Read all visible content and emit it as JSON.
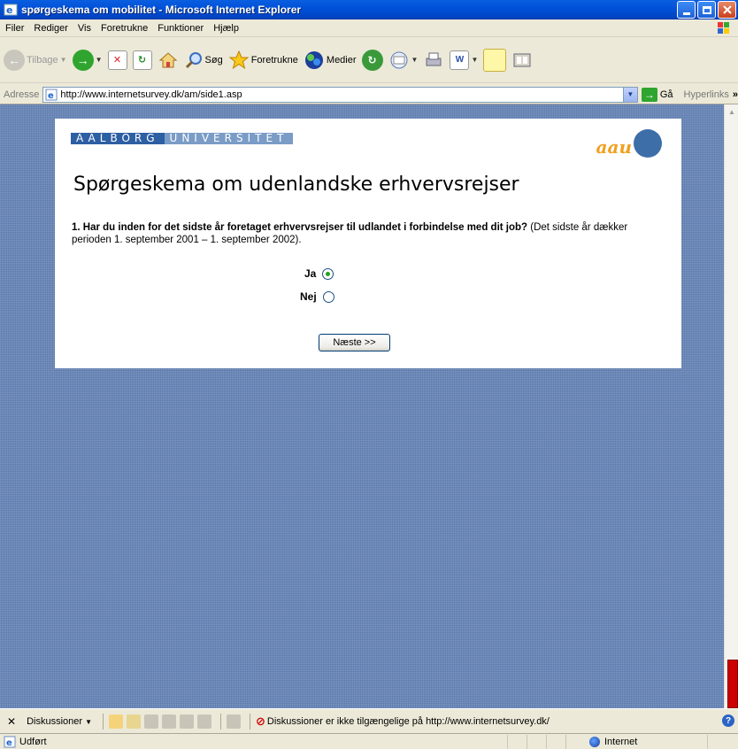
{
  "window": {
    "title": "spørgeskema om mobilitet - Microsoft Internet Explorer"
  },
  "menu": {
    "items": [
      "Filer",
      "Rediger",
      "Vis",
      "Foretrukne",
      "Funktioner",
      "Hjælp"
    ]
  },
  "toolbar": {
    "back_label": "Tilbage",
    "search_label": "Søg",
    "favorites_label": "Foretrukne",
    "media_label": "Medier"
  },
  "address": {
    "label": "Adresse",
    "url": "http://www.internetsurvey.dk/am/side1.asp",
    "go_label": "Gå",
    "links_label": "Hyperlinks"
  },
  "page": {
    "banner_part1": "AALBORG",
    "banner_part2": "UNIVERSITET",
    "logo_text": "aau",
    "title": "Spørgeskema om udenlandske erhvervsrejser",
    "question_bold": "1. Har du inden for det sidste år foretaget erhvervsrejser til udlandet i forbindelse med dit job?",
    "question_rest": " (Det sidste år dækker perioden 1. september 2001 – 1. september 2002).",
    "options": [
      {
        "label": "Ja",
        "selected": true
      },
      {
        "label": "Nej",
        "selected": false
      }
    ],
    "next_button": "Næste >>"
  },
  "discussion": {
    "button_label": "Diskussioner",
    "message": "Diskussioner er ikke tilgængelige på http://www.internetsurvey.dk/"
  },
  "status": {
    "text": "Udført",
    "zone": "Internet"
  },
  "colors": {
    "titlebar": "#0051d8",
    "background": "#5878ac",
    "banner": "#2d5fa3",
    "logo_orange": "#f0a020"
  }
}
